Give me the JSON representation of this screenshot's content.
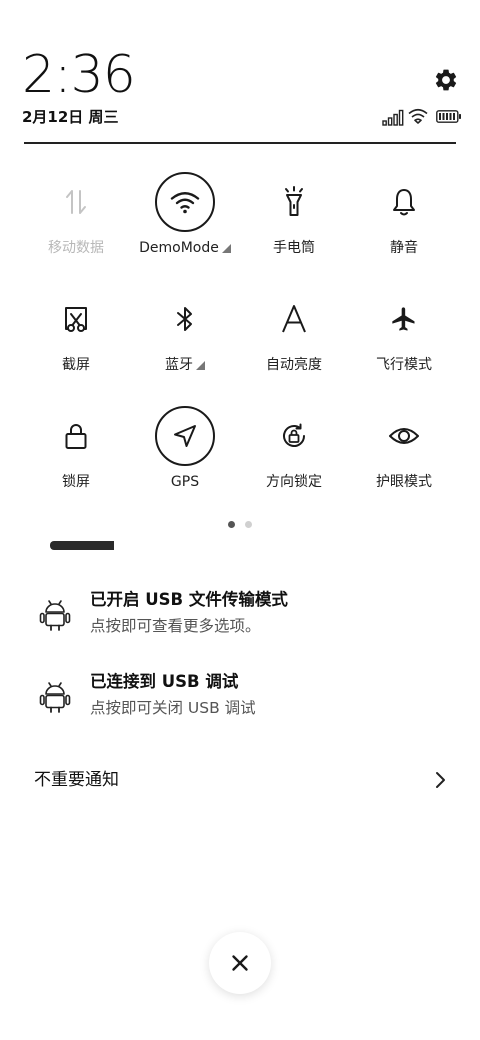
{
  "header": {
    "time": "2:36",
    "date": "2月12日 周三"
  },
  "status_icons": [
    "signal-icon",
    "wifi-icon",
    "battery-icon"
  ],
  "tiles": [
    {
      "label": "移动数据",
      "icon": "mobile-data-icon",
      "active": false,
      "disabled": true,
      "has_caret": false
    },
    {
      "label": "DemoMode",
      "icon": "wifi-icon",
      "active": true,
      "disabled": false,
      "has_caret": true
    },
    {
      "label": "手电筒",
      "icon": "flashlight-icon",
      "active": false,
      "disabled": false,
      "has_caret": false
    },
    {
      "label": "静音",
      "icon": "bell-icon",
      "active": false,
      "disabled": false,
      "has_caret": false
    },
    {
      "label": "截屏",
      "icon": "screenshot-icon",
      "active": false,
      "disabled": false,
      "has_caret": false
    },
    {
      "label": "蓝牙",
      "icon": "bluetooth-icon",
      "active": false,
      "disabled": false,
      "has_caret": true
    },
    {
      "label": "自动亮度",
      "icon": "auto-brightness-icon",
      "active": false,
      "disabled": false,
      "has_caret": false
    },
    {
      "label": "飞行模式",
      "icon": "airplane-icon",
      "active": false,
      "disabled": false,
      "has_caret": false
    },
    {
      "label": "锁屏",
      "icon": "lock-icon",
      "active": false,
      "disabled": false,
      "has_caret": false
    },
    {
      "label": "GPS",
      "icon": "location-arrow-icon",
      "active": true,
      "disabled": false,
      "has_caret": false
    },
    {
      "label": "方向锁定",
      "icon": "rotation-lock-icon",
      "active": false,
      "disabled": false,
      "has_caret": false
    },
    {
      "label": "护眼模式",
      "icon": "eye-icon",
      "active": false,
      "disabled": false,
      "has_caret": false
    }
  ],
  "page_indicator": {
    "pages": 2,
    "current": 1
  },
  "notifications": [
    {
      "title": "已开启 USB 文件传输模式",
      "body": "点按即可查看更多选项。",
      "icon": "android-icon"
    },
    {
      "title": "已连接到 USB 调试",
      "body": "点按即可关闭 USB 调试",
      "icon": "android-icon"
    }
  ],
  "unimportant_notifications": {
    "label": "不重要通知",
    "icon": "chevron-right-icon"
  },
  "close_button": {
    "icon": "close-icon"
  },
  "colors": {
    "background": "#ffffff",
    "text": "#1a1a1a",
    "disabled": "#b8b8b8",
    "secondary_text": "#555555"
  }
}
